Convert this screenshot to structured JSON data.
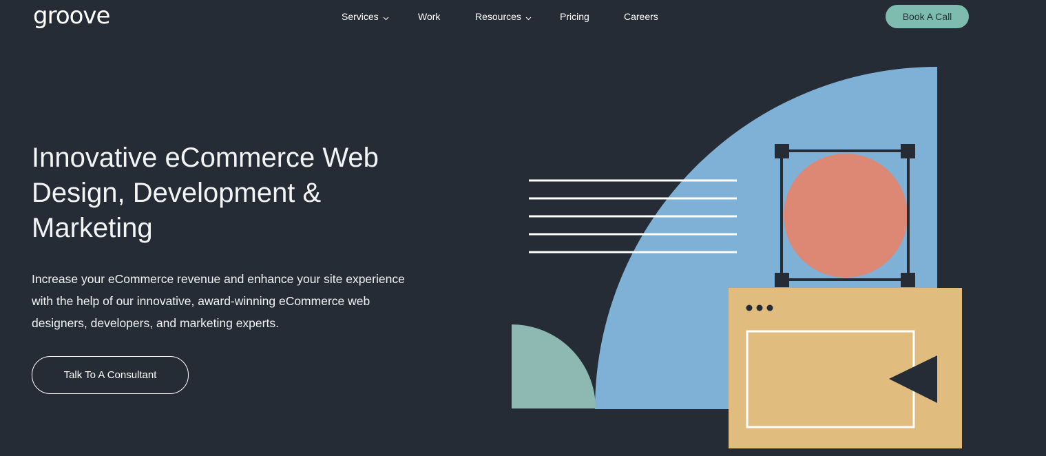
{
  "header": {
    "logo": "groove",
    "nav": [
      {
        "label": "Services",
        "has_dropdown": true
      },
      {
        "label": "Work",
        "has_dropdown": false
      },
      {
        "label": "Resources",
        "has_dropdown": true
      },
      {
        "label": "Pricing",
        "has_dropdown": false
      },
      {
        "label": "Careers",
        "has_dropdown": false
      }
    ],
    "book_button": "Book A Call"
  },
  "hero": {
    "title": "Innovative eCommerce Web Design, Development & Marketing",
    "description": "Increase your eCommerce revenue and enhance your site experience with the help of our innovative, award-winning eCommerce web designers, developers, and marketing experts.",
    "cta_label": "Talk To A Consultant"
  },
  "icons": {
    "dropdown": "chevron-down-icon",
    "illustration": "web-design-illustration"
  },
  "colors": {
    "background": "#262c35",
    "accent_teal": "#7ebcb0",
    "blue": "#7fb0d6",
    "salmon": "#dd8775",
    "sand": "#e0bc7f",
    "sage": "#8eb8b2",
    "white": "#ffffff"
  }
}
